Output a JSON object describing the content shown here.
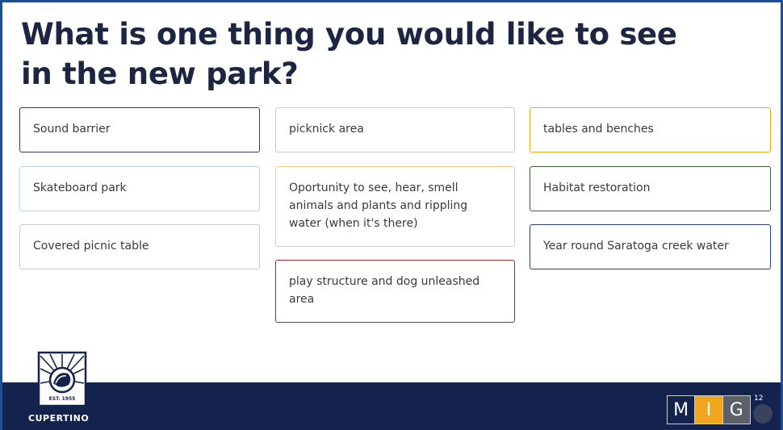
{
  "slide": {
    "title": "What is one thing you would like to see in the new park?",
    "page_number": "12"
  },
  "responses": {
    "col1": [
      {
        "text": "Sound barrier",
        "border": "#2b3f73"
      },
      {
        "text": "Skateboard park",
        "border": "#b9d3ea"
      },
      {
        "text": "Covered picnic table",
        "border": "#c8c8c8"
      }
    ],
    "col2": [
      {
        "text": "picknick area",
        "border": "#c8c8c8"
      },
      {
        "text": "Oportunity to see, hear, smell animals and plants and rippling water (when it's there)",
        "border": "#f2cf7c"
      },
      {
        "text": "play structure and dog unleashed area",
        "border": "#9b2c2c"
      }
    ],
    "col3": [
      {
        "text": "tables and benches",
        "border": "#f0a71e"
      },
      {
        "text": "Habitat restoration",
        "border": "#3f5f3a"
      },
      {
        "text": "Year round Saratoga creek water",
        "border": "#2b3f73"
      }
    ]
  },
  "branding": {
    "city_logo_text": "CUPERTINO",
    "city_logo_est": "EST. 1955",
    "partner_letters": [
      "M",
      "I",
      "G"
    ]
  },
  "colors": {
    "title": "#1c2541",
    "footer": "#13234d",
    "accent_orange": "#f0a71e",
    "frame": "#1f4e96"
  }
}
